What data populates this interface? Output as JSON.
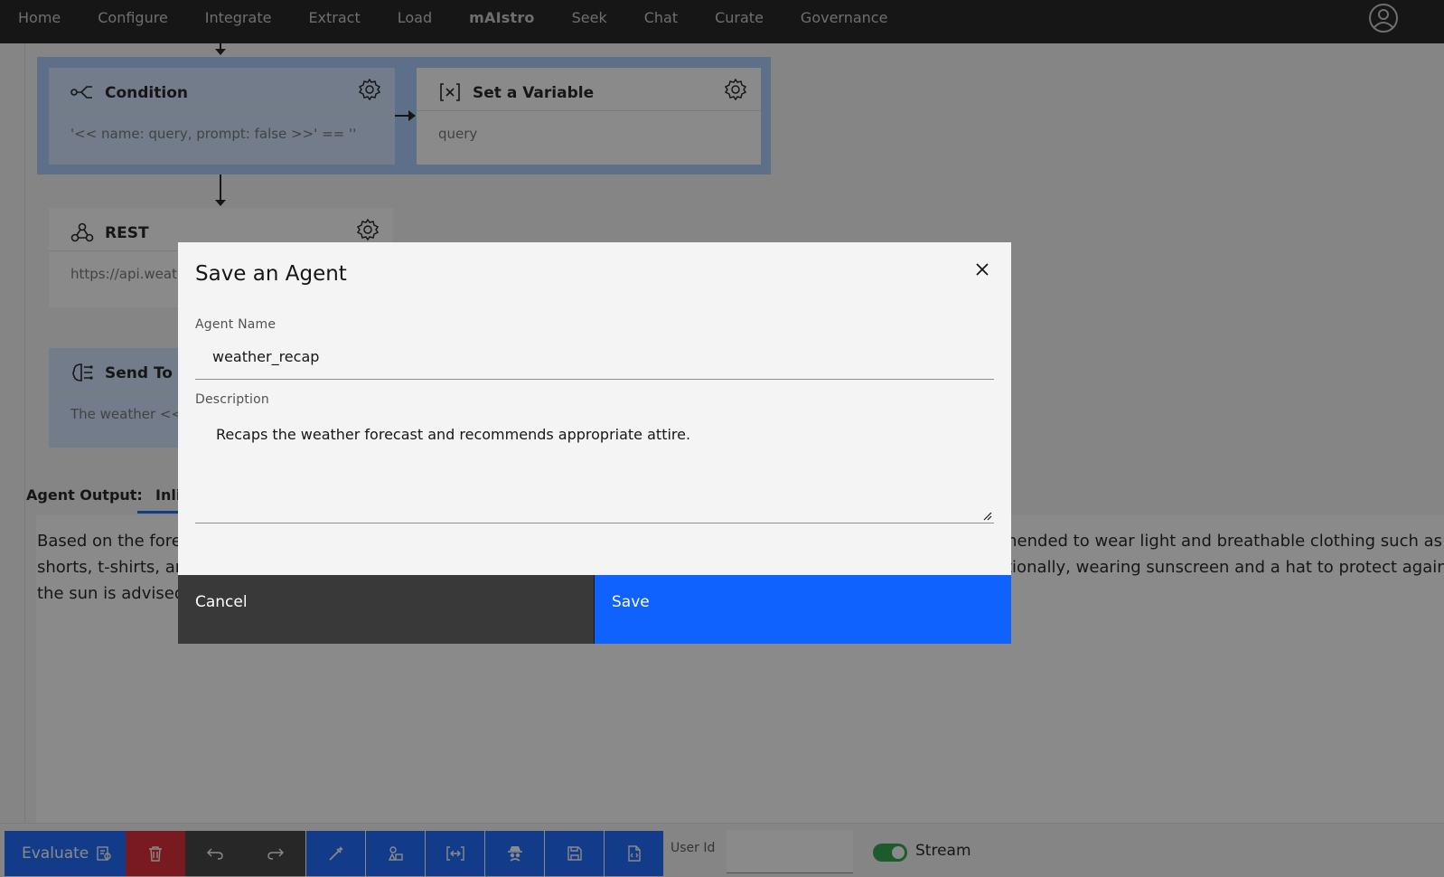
{
  "nav": {
    "items": [
      "Home",
      "Configure",
      "Integrate",
      "Extract",
      "Load",
      "mAIstro",
      "Seek",
      "Chat",
      "Curate",
      "Governance"
    ],
    "user_icon": "user-avatar-icon"
  },
  "flow": {
    "condition": {
      "title": "Condition",
      "body": "'<< name: query, prompt: false >>' == ''"
    },
    "set_variable": {
      "title": "Set a Variable",
      "body": "query"
    },
    "rest": {
      "title": "REST",
      "body": "https://api.weat"
    },
    "send_to_llm": {
      "title": "Send To L",
      "body": "The weather <<"
    }
  },
  "output": {
    "label": "Agent Output:",
    "tab": "Inli",
    "line1_left": "Based on the forec",
    "line1_right": "mended to wear light and breathable clothing such as",
    "line2_left": "shorts, t-shirts, an",
    "line2_right": "itionally, wearing sunscreen and a hat to protect against",
    "line3_left": "the sun is advised."
  },
  "modal": {
    "title": "Save an Agent",
    "name_label": "Agent Name",
    "name_value": "weather_recap",
    "description_label": "Description",
    "description_value": "Recaps the weather forecast and recommends appropriate attire.",
    "cancel_label": "Cancel",
    "save_label": "Save"
  },
  "toolbar": {
    "evaluate_label": "Evaluate",
    "user_id_label": "User Id",
    "user_id_value": "",
    "stream_label": "Stream",
    "stream_on": true
  },
  "colors": {
    "nav_bg": "#161616",
    "primary": "#0f62fe",
    "danger": "#da1e28",
    "toggle_on": "#24a148"
  }
}
